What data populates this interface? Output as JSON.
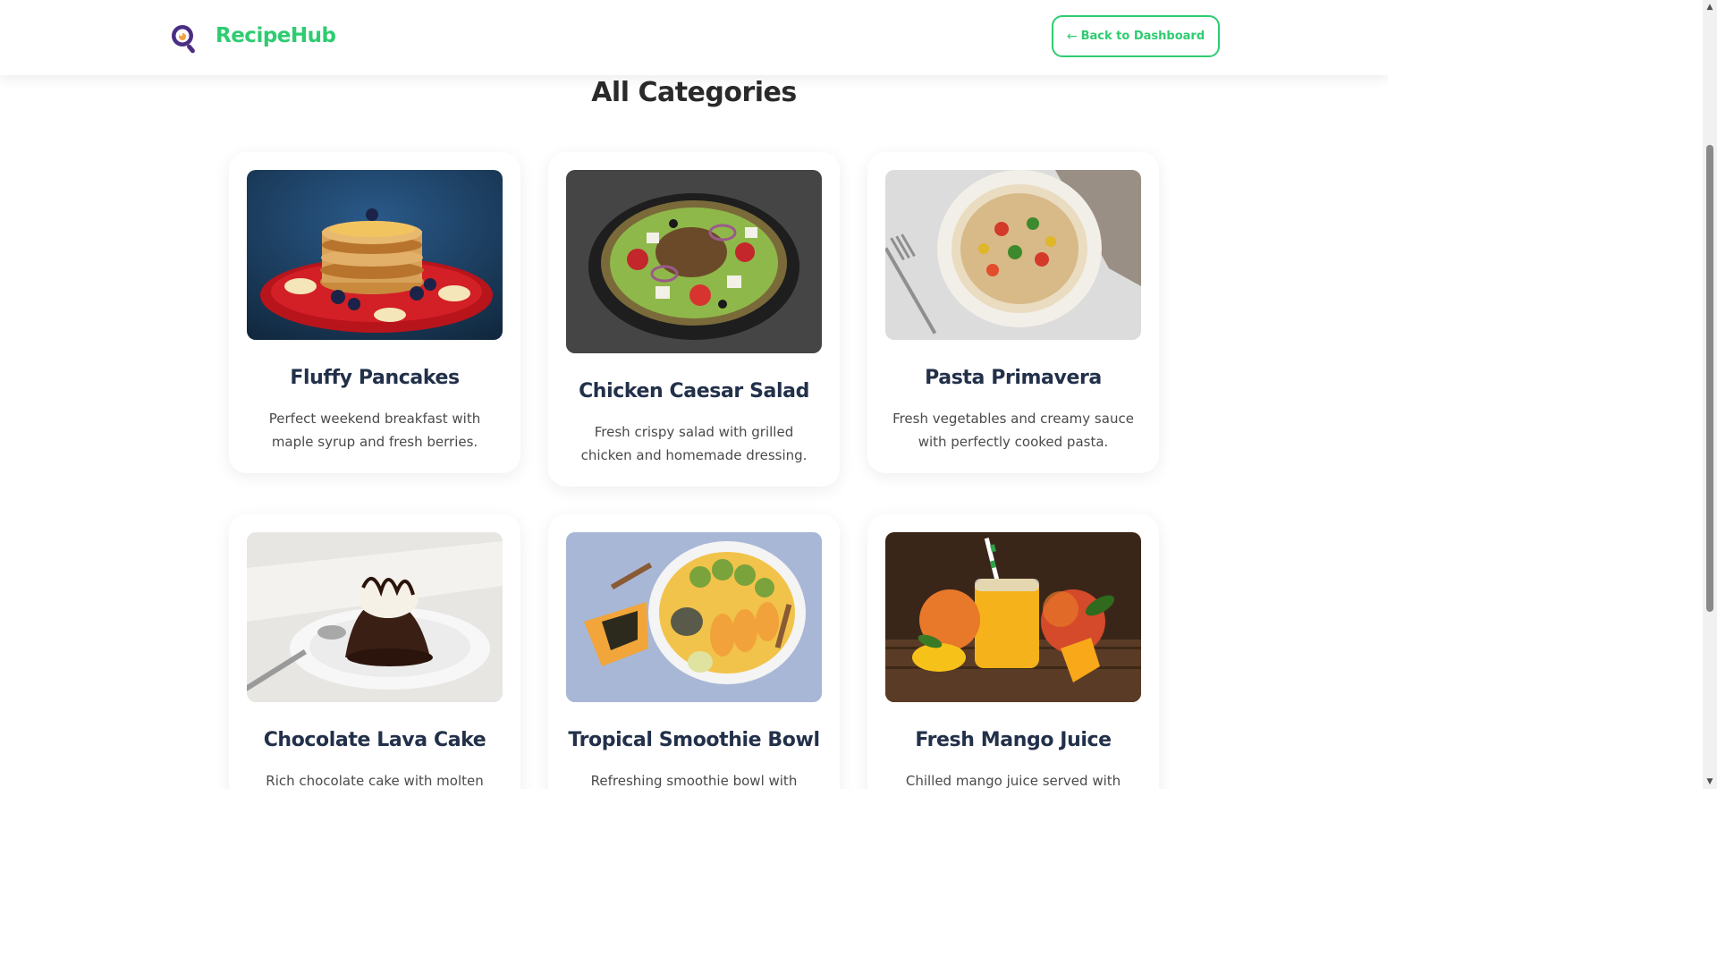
{
  "header": {
    "brand": "RecipeHub",
    "logo_icon": "magnifier-logo-icon",
    "back_button": {
      "arrow": "←",
      "label": "Back to Dashboard"
    }
  },
  "main": {
    "title": "All Categories",
    "cards": [
      {
        "title": "Fluffy Pancakes",
        "description": "Perfect weekend breakfast with maple syrup and fresh berries.",
        "image": "pancakes-image"
      },
      {
        "title": "Chicken Caesar Salad",
        "description": "Fresh crispy salad with grilled chicken and homemade dressing.",
        "image": "salad-image"
      },
      {
        "title": "Pasta Primavera",
        "description": "Fresh vegetables and creamy sauce with perfectly cooked pasta.",
        "image": "pasta-image"
      },
      {
        "title": "Chocolate Lava Cake",
        "description": "Rich chocolate cake with molten",
        "image": "lava-cake-image"
      },
      {
        "title": "Tropical Smoothie Bowl",
        "description": "Refreshing smoothie bowl with mango,",
        "image": "smoothie-bowl-image"
      },
      {
        "title": "Fresh Mango Juice",
        "description": "Chilled mango juice served with mint",
        "image": "mango-juice-image"
      }
    ]
  },
  "colors": {
    "accent": "#2ecc71",
    "logo_purple": "#4b2e83",
    "title_dark": "#22304a"
  }
}
